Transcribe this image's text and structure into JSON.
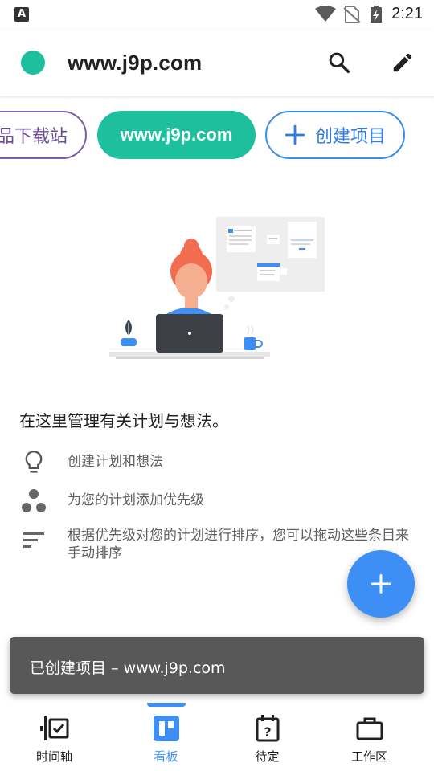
{
  "status_bar": {
    "left_icon": "A",
    "icons": [
      "wifi-icon",
      "no-sim-icon",
      "battery-charging-icon"
    ],
    "time": "2:21"
  },
  "app_bar": {
    "project_color": "#1dbf9c",
    "title": "www.j9p.com",
    "search_icon": "search-icon",
    "edit_icon": "pencil-icon"
  },
  "chips": {
    "previous": "品下载站",
    "active": "www.j9p.com",
    "create": "创建项目",
    "create_icon": "plus-icon"
  },
  "empty_state": {
    "illustration": "person-at-laptop-illustration",
    "intro": "在这里管理有关计划与想法。",
    "features": [
      {
        "icon": "lightbulb-icon",
        "text": "创建计划和想法"
      },
      {
        "icon": "priority-dots-icon",
        "text": "为您的计划添加优先级"
      },
      {
        "icon": "sort-lines-icon",
        "text": "根据优先级对您的计划进行排序，您可以拖动这些条目来手动排序"
      }
    ]
  },
  "fab": {
    "icon": "plus-icon",
    "color": "#3d8ef5"
  },
  "snackbar": {
    "text": "已创建项目 – www.j9p.com"
  },
  "bottom_nav": {
    "accent": "#3d8ef5",
    "active_index": 1,
    "items": [
      {
        "label": "时间轴",
        "icon": "timeline-icon"
      },
      {
        "label": "看板",
        "icon": "board-icon"
      },
      {
        "label": "待定",
        "icon": "pending-calendar-icon"
      },
      {
        "label": "工作区",
        "icon": "briefcase-icon"
      }
    ]
  }
}
